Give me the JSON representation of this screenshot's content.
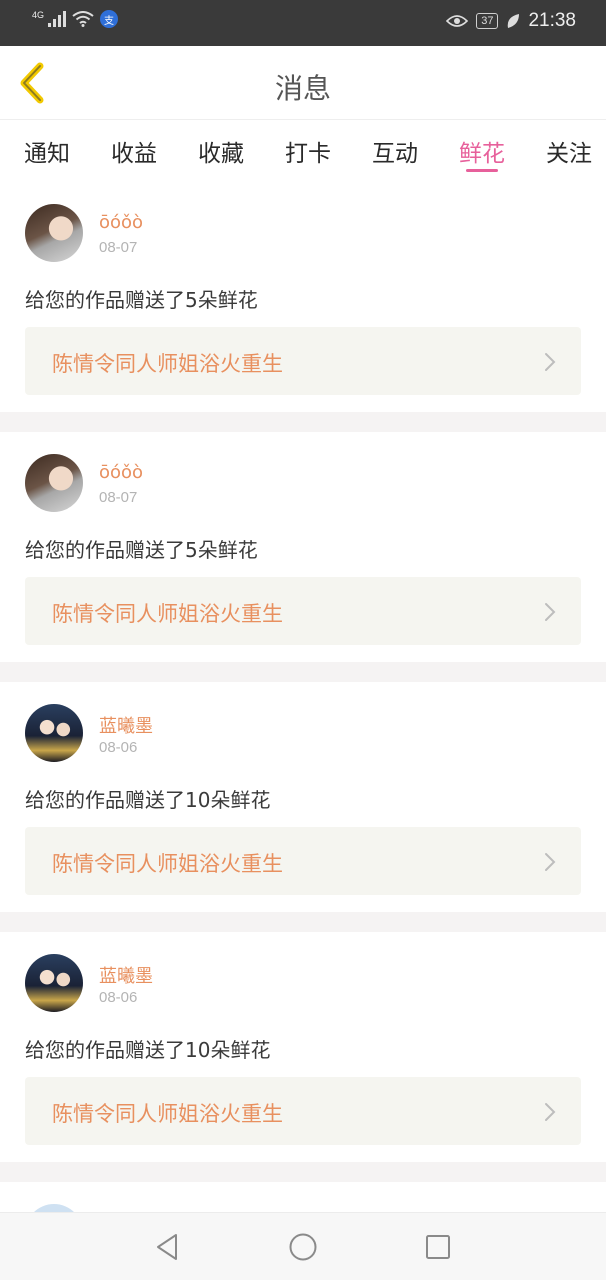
{
  "status_bar": {
    "network": "4G",
    "battery": "37",
    "time": "21:38",
    "app_badge": "支"
  },
  "header": {
    "title": "消息"
  },
  "tabs": [
    {
      "label": "通知",
      "active": false
    },
    {
      "label": "收益",
      "active": false
    },
    {
      "label": "收藏",
      "active": false
    },
    {
      "label": "打卡",
      "active": false
    },
    {
      "label": "互动",
      "active": false
    },
    {
      "label": "鲜花",
      "active": true
    },
    {
      "label": "关注",
      "active": false
    }
  ],
  "messages": [
    {
      "username": "ōóǒò",
      "date": "08-07",
      "text": "给您的作品赠送了5朵鲜花",
      "work": "陈情令同人师姐浴火重生"
    },
    {
      "username": "ōóǒò",
      "date": "08-07",
      "text": "给您的作品赠送了5朵鲜花",
      "work": "陈情令同人师姐浴火重生"
    },
    {
      "username": "蓝曦墨",
      "date": "08-06",
      "text": "给您的作品赠送了10朵鲜花",
      "work": "陈情令同人师姐浴火重生"
    },
    {
      "username": "蓝曦墨",
      "date": "08-06",
      "text": "给您的作品赠送了10朵鲜花",
      "work": "陈情令同人师姐浴火重生"
    }
  ],
  "colors": {
    "accent": "#e7609b",
    "username": "#e8905f",
    "back_arrow": "#f2c900"
  },
  "icons": {
    "back": "back-arrow-icon",
    "card_arrow": "chevron-right-icon",
    "nav": [
      "nav-back-icon",
      "nav-home-icon",
      "nav-recents-icon"
    ]
  }
}
